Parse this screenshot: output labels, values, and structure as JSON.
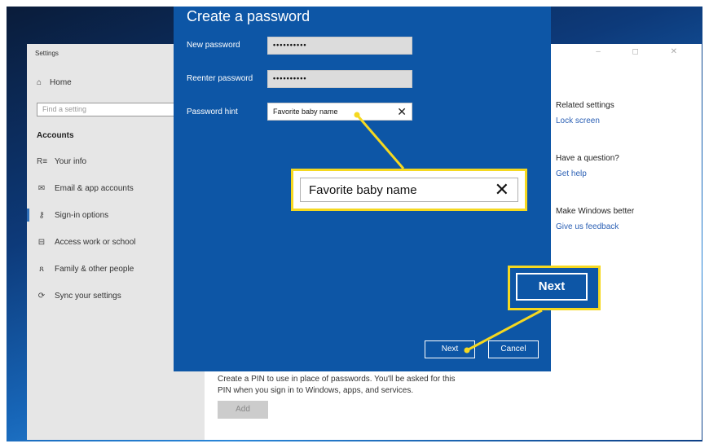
{
  "settings_window": {
    "title": "Settings",
    "controls": "– ◻ ✕"
  },
  "sidebar": {
    "home_label": "Home",
    "search_placeholder": "Find a setting",
    "section_heading": "Accounts",
    "items": [
      {
        "label": "Your info",
        "icon": "person-card-icon",
        "glyph": "R≡"
      },
      {
        "label": "Email & app accounts",
        "icon": "envelope-icon",
        "glyph": "✉"
      },
      {
        "label": "Sign-in options",
        "icon": "key-icon",
        "glyph": "⚷"
      },
      {
        "label": "Access work or school",
        "icon": "briefcase-icon",
        "glyph": "⊟"
      },
      {
        "label": "Family & other people",
        "icon": "people-icon",
        "glyph": "ጸ"
      },
      {
        "label": "Sync your settings",
        "icon": "sync-icon",
        "glyph": "⟳"
      }
    ]
  },
  "related": {
    "related_heading": "Related settings",
    "lock_screen": "Lock screen",
    "question_heading": "Have a question?",
    "get_help": "Get help",
    "better_heading": "Make Windows better",
    "feedback": "Give us feedback"
  },
  "pin": {
    "description": "Create a PIN to use in place of passwords. You'll be asked for this PIN when you sign in to Windows, apps, and services.",
    "add_label": "Add"
  },
  "dialog": {
    "title": "Create a password",
    "new_password_label": "New password",
    "new_password_value": "••••••••••",
    "reenter_label": "Reenter password",
    "reenter_value": "••••••••••",
    "hint_label": "Password hint",
    "hint_value": "Favorite baby name",
    "next_label": "Next",
    "cancel_label": "Cancel"
  },
  "callouts": {
    "hint_zoom_value": "Favorite baby name",
    "next_zoom_label": "Next",
    "accent_color": "#f5d820"
  },
  "colors": {
    "dialog_bg": "#0d56a6",
    "link": "#2a5fb4"
  }
}
